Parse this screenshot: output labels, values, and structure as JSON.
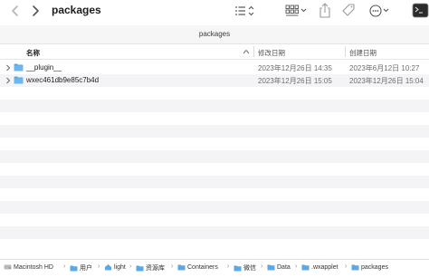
{
  "window": {
    "title": "packages",
    "path_title": "packages"
  },
  "toolbar": {
    "back_icon": "chevron-left-icon",
    "forward_icon": "chevron-right-icon",
    "list_view_icon": "list-icon",
    "group_icon": "grid-icon",
    "share_icon": "share-icon",
    "tag_icon": "tag-icon",
    "more_icon": "ellipsis-circle-icon",
    "terminal_icon": "terminal-icon"
  },
  "columns": {
    "name": "名称",
    "modified": "修改日期",
    "created": "创建日期"
  },
  "files": [
    {
      "name": "__plugin__",
      "modified": "2023年12月26日 14:35",
      "created": "2023年6月12日 10:27"
    },
    {
      "name": "wxec461db9e85c7b4d",
      "modified": "2023年12月26日 15:05",
      "created": "2023年12月26日 15:04"
    }
  ],
  "breadcrumb": [
    {
      "label": "Macintosh HD",
      "icon": "disk-icon"
    },
    {
      "label": "用户",
      "icon": "folder-icon"
    },
    {
      "label": "light",
      "icon": "home-icon"
    },
    {
      "label": "资源库",
      "icon": "folder-icon"
    },
    {
      "label": "Containers",
      "icon": "folder-icon"
    },
    {
      "label": "微信",
      "icon": "folder-icon"
    },
    {
      "label": "Data",
      "icon": "folder-icon"
    },
    {
      "label": ".wxapplet",
      "icon": "folder-icon"
    },
    {
      "label": "packages",
      "icon": "folder-icon"
    }
  ],
  "colors": {
    "folder": "#5aa9e6",
    "row_alt": "#f4f4f6"
  }
}
